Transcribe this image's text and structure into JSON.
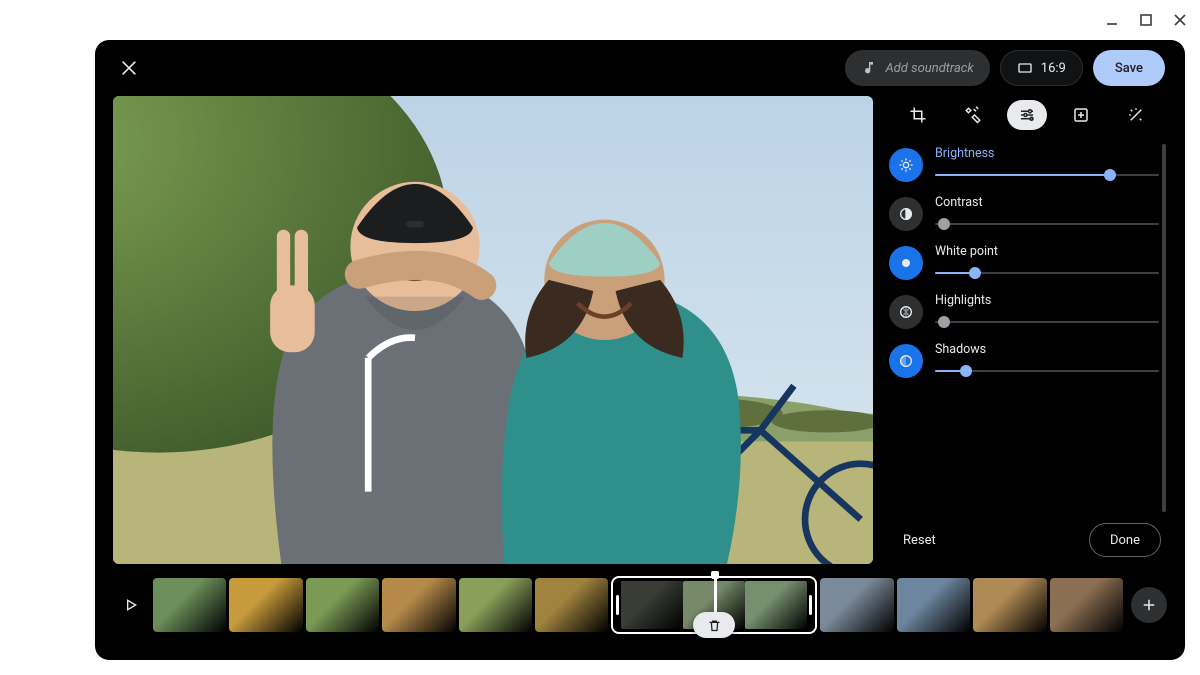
{
  "window_controls": {
    "minimize": "minimize",
    "maximize": "maximize",
    "close": "close"
  },
  "topbar": {
    "close_label": "Close",
    "add_soundtrack_label": "Add soundtrack",
    "aspect_label": "16:9",
    "save_label": "Save"
  },
  "panel": {
    "tabs": [
      {
        "id": "crop",
        "label": "Crop & rotate"
      },
      {
        "id": "tools",
        "label": "Tools"
      },
      {
        "id": "adjust",
        "label": "Adjust",
        "active": true
      },
      {
        "id": "filters",
        "label": "Filters"
      },
      {
        "id": "effects",
        "label": "Effects"
      }
    ],
    "sliders": [
      {
        "id": "brightness",
        "label": "Brightness",
        "value": 78,
        "active": true
      },
      {
        "id": "contrast",
        "label": "Contrast",
        "value": 4,
        "active": false
      },
      {
        "id": "white_point",
        "label": "White point",
        "value": 18,
        "active": true
      },
      {
        "id": "highlights",
        "label": "Highlights",
        "value": 4,
        "active": false
      },
      {
        "id": "shadows",
        "label": "Shadows",
        "value": 14,
        "active": true
      }
    ],
    "reset_label": "Reset",
    "done_label": "Done"
  },
  "timeline": {
    "play_label": "Play",
    "add_clip_label": "Add clip",
    "delete_clip_label": "Delete clip",
    "clips_before": 6,
    "selected_frames": 3,
    "clips_after": 4,
    "colors_before": [
      "#6b8e5a",
      "#c79a3b",
      "#7a9a55",
      "#b5894a",
      "#8aa05a",
      "#a0833e"
    ],
    "colors_selected": [
      "#6e7c62",
      "#768a6a",
      "#76906e"
    ],
    "colors_after": [
      "#7b8a9a",
      "#6d86a0",
      "#b08a55",
      "#8c6e52"
    ]
  },
  "preview": {
    "alt": "Two friends with bike helmets posing with a blue bicycle in a sunny park; the person on the left makes a peace sign."
  }
}
